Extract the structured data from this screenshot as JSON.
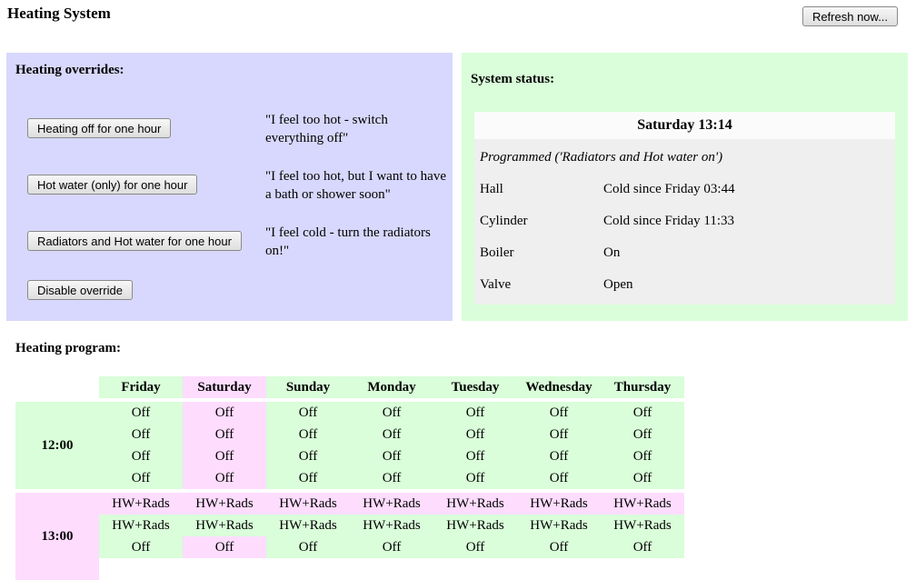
{
  "header": {
    "title": "Heating System",
    "refresh_label": "Refresh now..."
  },
  "overrides": {
    "title": "Heating overrides:",
    "items": [
      {
        "button": "Heating off for one hour",
        "quote": "\"I feel too hot - switch everything off\""
      },
      {
        "button": "Hot water (only) for one hour",
        "quote": "\"I feel too hot, but I want to have a bath or shower soon\""
      },
      {
        "button": "Radiators and Hot water for one hour",
        "quote": "\"I feel cold - turn the radiators on!\""
      }
    ],
    "disable_label": "Disable override"
  },
  "status": {
    "title": "System status:",
    "datetime": "Saturday 13:14",
    "programmed": "Programmed ('Radiators and Hot water on')",
    "rows": [
      {
        "label": "Hall",
        "value": "Cold since Friday 03:44"
      },
      {
        "label": "Cylinder",
        "value": "Cold since Friday 11:33"
      },
      {
        "label": "Boiler",
        "value": "On"
      },
      {
        "label": "Valve",
        "value": "Open"
      }
    ]
  },
  "program": {
    "title": "Heating program:",
    "days": [
      "Friday",
      "Saturday",
      "Sunday",
      "Monday",
      "Tuesday",
      "Wednesday",
      "Thursday"
    ],
    "current_day_index": 1,
    "blocks": [
      {
        "time": "12:00",
        "rows": [
          [
            "Off",
            "Off",
            "Off",
            "Off",
            "Off",
            "Off",
            "Off"
          ],
          [
            "Off",
            "Off",
            "Off",
            "Off",
            "Off",
            "Off",
            "Off"
          ],
          [
            "Off",
            "Off",
            "Off",
            "Off",
            "Off",
            "Off",
            "Off"
          ],
          [
            "Off",
            "Off",
            "Off",
            "Off",
            "Off",
            "Off",
            "Off"
          ]
        ]
      },
      {
        "time": "13:00",
        "rows": [
          [
            "HW+Rads",
            "HW+Rads",
            "HW+Rads",
            "HW+Rads",
            "HW+Rads",
            "HW+Rads",
            "HW+Rads"
          ],
          [
            "HW+Rads",
            "HW+Rads",
            "HW+Rads",
            "HW+Rads",
            "HW+Rads",
            "HW+Rads",
            "HW+Rads"
          ],
          [
            "Off",
            "Off",
            "Off",
            "Off",
            "Off",
            "Off",
            "Off"
          ]
        ]
      }
    ]
  },
  "colors": {
    "overrides_bg": "#d8d8fe",
    "status_bg": "#d9fed9",
    "today_bg": "#fedcfe",
    "cell_green": "#d9fed9",
    "cell_pink": "#fedcfe"
  }
}
